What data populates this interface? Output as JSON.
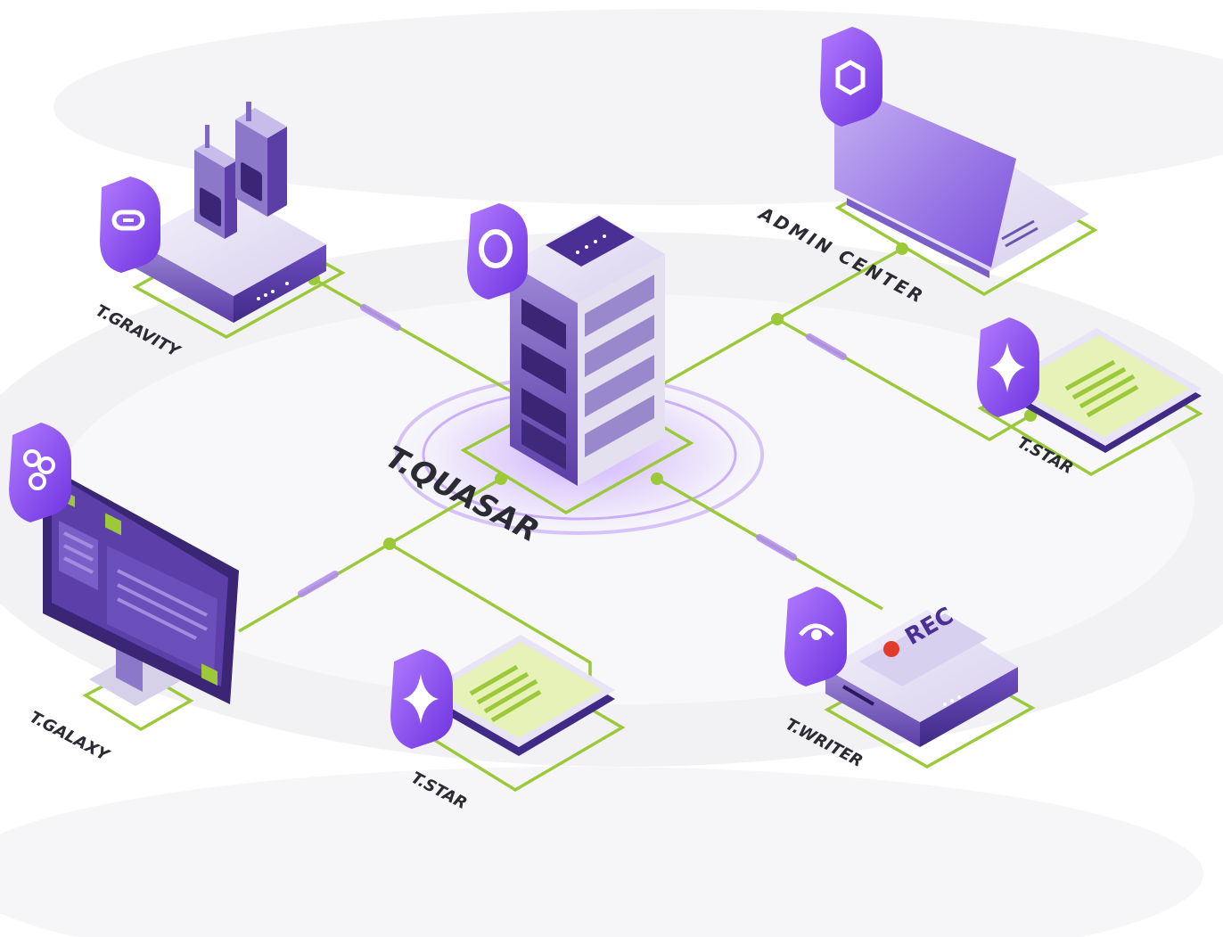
{
  "colors": {
    "purple": "#8b4fe6",
    "purple_dark": "#5a2fb0",
    "purple_light": "#b79af0",
    "green": "#9bc93a",
    "screen_green": "#e6f2b8",
    "rec_red": "#e23b2e",
    "label": "#2b2b33"
  },
  "nodes": {
    "center": {
      "label": "T.QUASAR",
      "icon": "quasar-ring-icon"
    },
    "gravity": {
      "label": "T.GRAVITY",
      "icon": "link-icon"
    },
    "admin": {
      "label": "ADMIN CENTER",
      "icon": "hexagon-nut-icon"
    },
    "star_right": {
      "label": "T.STAR",
      "icon": "sparkle-star-icon"
    },
    "galaxy": {
      "label": "T.GALAXY",
      "icon": "triskelion-icon"
    },
    "star_bottom": {
      "label": "T.STAR",
      "icon": "sparkle-star-icon"
    },
    "writer": {
      "label": "T.WRITER",
      "icon": "eye-icon",
      "badge": "REC"
    }
  }
}
